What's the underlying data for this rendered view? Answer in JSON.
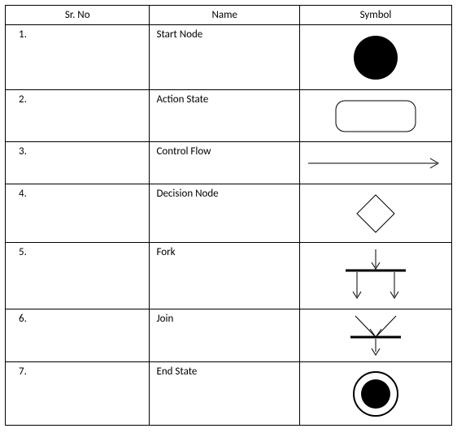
{
  "headers": {
    "col1": "Sr. No",
    "col2": "Name",
    "col3": "Symbol"
  },
  "rows": [
    {
      "sr": "1.",
      "name": "Start Node",
      "symbolKey": "start-node"
    },
    {
      "sr": "2.",
      "name": "Action State",
      "symbolKey": "action-state"
    },
    {
      "sr": "3.",
      "name": "Control Flow",
      "symbolKey": "control-flow"
    },
    {
      "sr": "4.",
      "name": "Decision Node",
      "symbolKey": "decision-node"
    },
    {
      "sr": "5.",
      "name": "Fork",
      "symbolKey": "fork"
    },
    {
      "sr": "6.",
      "name": "Join",
      "symbolKey": "join"
    },
    {
      "sr": "7.",
      "name": "End State",
      "symbolKey": "end-state"
    }
  ]
}
